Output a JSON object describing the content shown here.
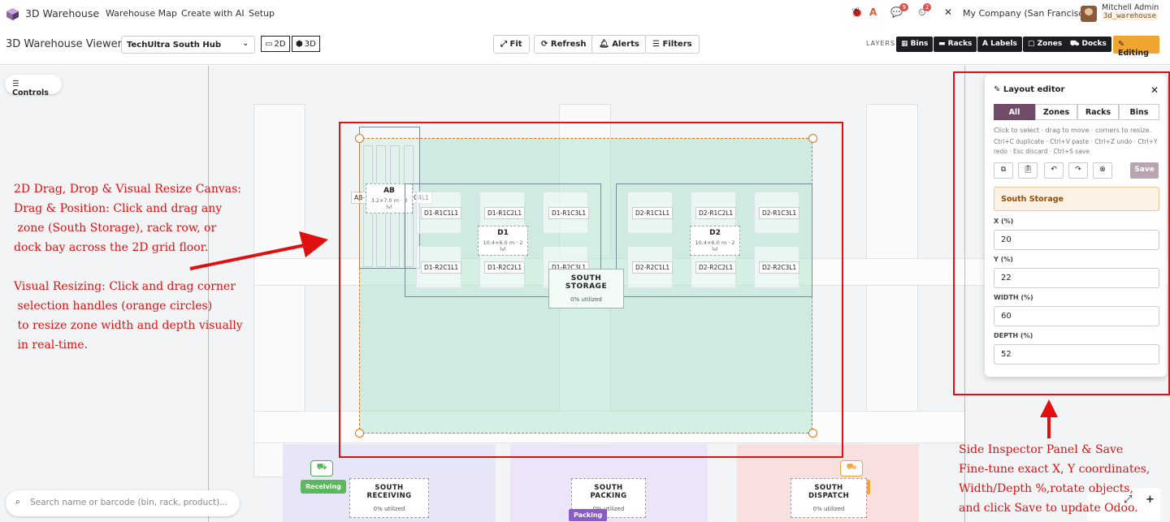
{
  "topnav": {
    "app_name": "3D Warehouse",
    "menu": [
      "Warehouse Map",
      "Create with AI",
      "Setup"
    ],
    "badges": {
      "messages": "9",
      "activity": "2"
    },
    "company": "My Company (San Francisco)",
    "user_name": "Mitchell Admin",
    "user_db": "3d_warehouse"
  },
  "toolbar": {
    "title": "3D Warehouse Viewer",
    "warehouse_select": "TechUltra South Hub",
    "view_2d": "2D",
    "view_3d": "3D",
    "fit": "Fit",
    "refresh": "Refresh",
    "alerts": "Alerts",
    "filters": "Filters",
    "layers_label": "LAYERS",
    "layers": [
      "Bins",
      "Racks",
      "Labels",
      "Zones",
      "Docks"
    ],
    "editing": "Editing"
  },
  "canvas": {
    "controls": "Controls",
    "rack_ab": {
      "name": "AB",
      "dims": "3.2×7.0 m · 3 lvl",
      "left_stub": "AB-",
      "right_stub": "C4L1"
    },
    "rack_d1": {
      "name": "D1",
      "dims": "10.4×6.0 m · 2 lvl"
    },
    "rack_d2": {
      "name": "D2",
      "dims": "10.4×6.0 m · 2 lvl"
    },
    "bins_d1_row1": [
      "D1-R1C1L1",
      "D1-R1C2L1",
      "D1-R1C3L1"
    ],
    "bins_d1_row2": [
      "D1-R2C1L1",
      "D1-R2C2L1",
      "D1-R2C3L1"
    ],
    "bins_d2_row1": [
      "D2-R1C1L1",
      "D2-R1C2L1",
      "D2-R1C3L1"
    ],
    "bins_d2_row2": [
      "D2-R2C1L1",
      "D2-R2C2L1",
      "D2-R2C3L1"
    ],
    "south_storage": {
      "name": "SOUTH STORAGE",
      "util": "0% utilized"
    },
    "south_receiving": {
      "name": "SOUTH RECEIVING",
      "util": "0% utilized",
      "tag": "Receiving"
    },
    "south_packing": {
      "name": "SOUTH PACKING",
      "util": "0% utilized",
      "tag": "Packing"
    },
    "south_dispatch": {
      "name": "SOUTH DISPATCH",
      "util": "0% utilized"
    },
    "search_placeholder": "Search name or barcode (bin, rack, product)..."
  },
  "editor": {
    "title": "Layout editor",
    "tabs": [
      "All",
      "Zones",
      "Racks",
      "Bins"
    ],
    "help1": "Click to select · drag to move · corners to resize.",
    "help2": "Ctrl+C duplicate · Ctrl+V paste · Ctrl+Z undo · Ctrl+Y redo · Esc discard · Ctrl+S save",
    "save": "Save",
    "selected": "South Storage",
    "x_label": "X (%)",
    "x_value": "20",
    "y_label": "Y (%)",
    "y_value": "22",
    "w_label": "WIDTH (%)",
    "w_value": "60",
    "d_label": "DEPTH (%)",
    "d_value": "52"
  },
  "annotations": {
    "left": "2D Drag, Drop & Visual Resize Canvas:\nDrag & Position: Click and drag any\n zone (South Storage), rack row, or\ndock bay across the 2D grid floor.\n\nVisual Resizing: Click and drag corner\n selection handles (orange circles)\n to resize zone width and depth visually\n in real-time.",
    "right": "Side Inspector Panel & Save\nFine-tune exact X, Y coordinates,\nWidth/Depth %,rotate objects,\nand click Save to update Odoo."
  },
  "colors": {
    "accent": "#714b67",
    "editing": "#f0a531",
    "annotation": "#e01010",
    "handle": "#e0731a"
  }
}
